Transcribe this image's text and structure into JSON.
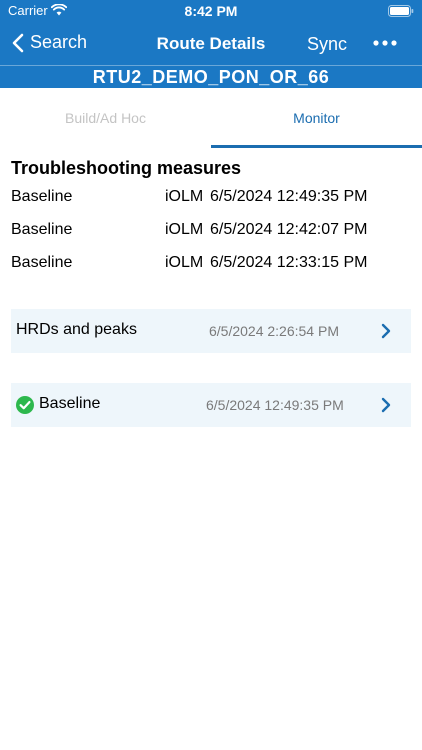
{
  "status_bar": {
    "carrier": "Carrier",
    "time": "8:42 PM"
  },
  "nav": {
    "back_label": "Search",
    "title": "Route Details",
    "sync_label": "Sync",
    "route_name": "RTU2_DEMO_PON_OR_66"
  },
  "tabs": [
    {
      "label": "Build/Ad Hoc",
      "active": false
    },
    {
      "label": "Monitor",
      "active": true
    }
  ],
  "troubleshooting": {
    "title": "Troubleshooting measures",
    "rows": [
      {
        "name": "Baseline",
        "type": "iOLM",
        "date": "6/5/2024 12:49:35 PM"
      },
      {
        "name": "Baseline",
        "type": "iOLM",
        "date": "6/5/2024 12:42:07 PM"
      },
      {
        "name": "Baseline",
        "type": "iOLM",
        "date": "6/5/2024 12:33:15 PM"
      }
    ]
  },
  "cards": [
    {
      "label": "HRDs and peaks",
      "date": "6/5/2024 2:26:54 PM",
      "icon": "chevron-right-icon"
    },
    {
      "label": "Baseline",
      "date": "6/5/2024 12:49:35 PM",
      "status_icon": "check-circle-icon",
      "icon": "chevron-right-icon"
    }
  ],
  "colors": {
    "header": "#1b78c4",
    "accent": "#1b6db0",
    "card_bg": "#eef6fb",
    "success": "#2db84d"
  }
}
